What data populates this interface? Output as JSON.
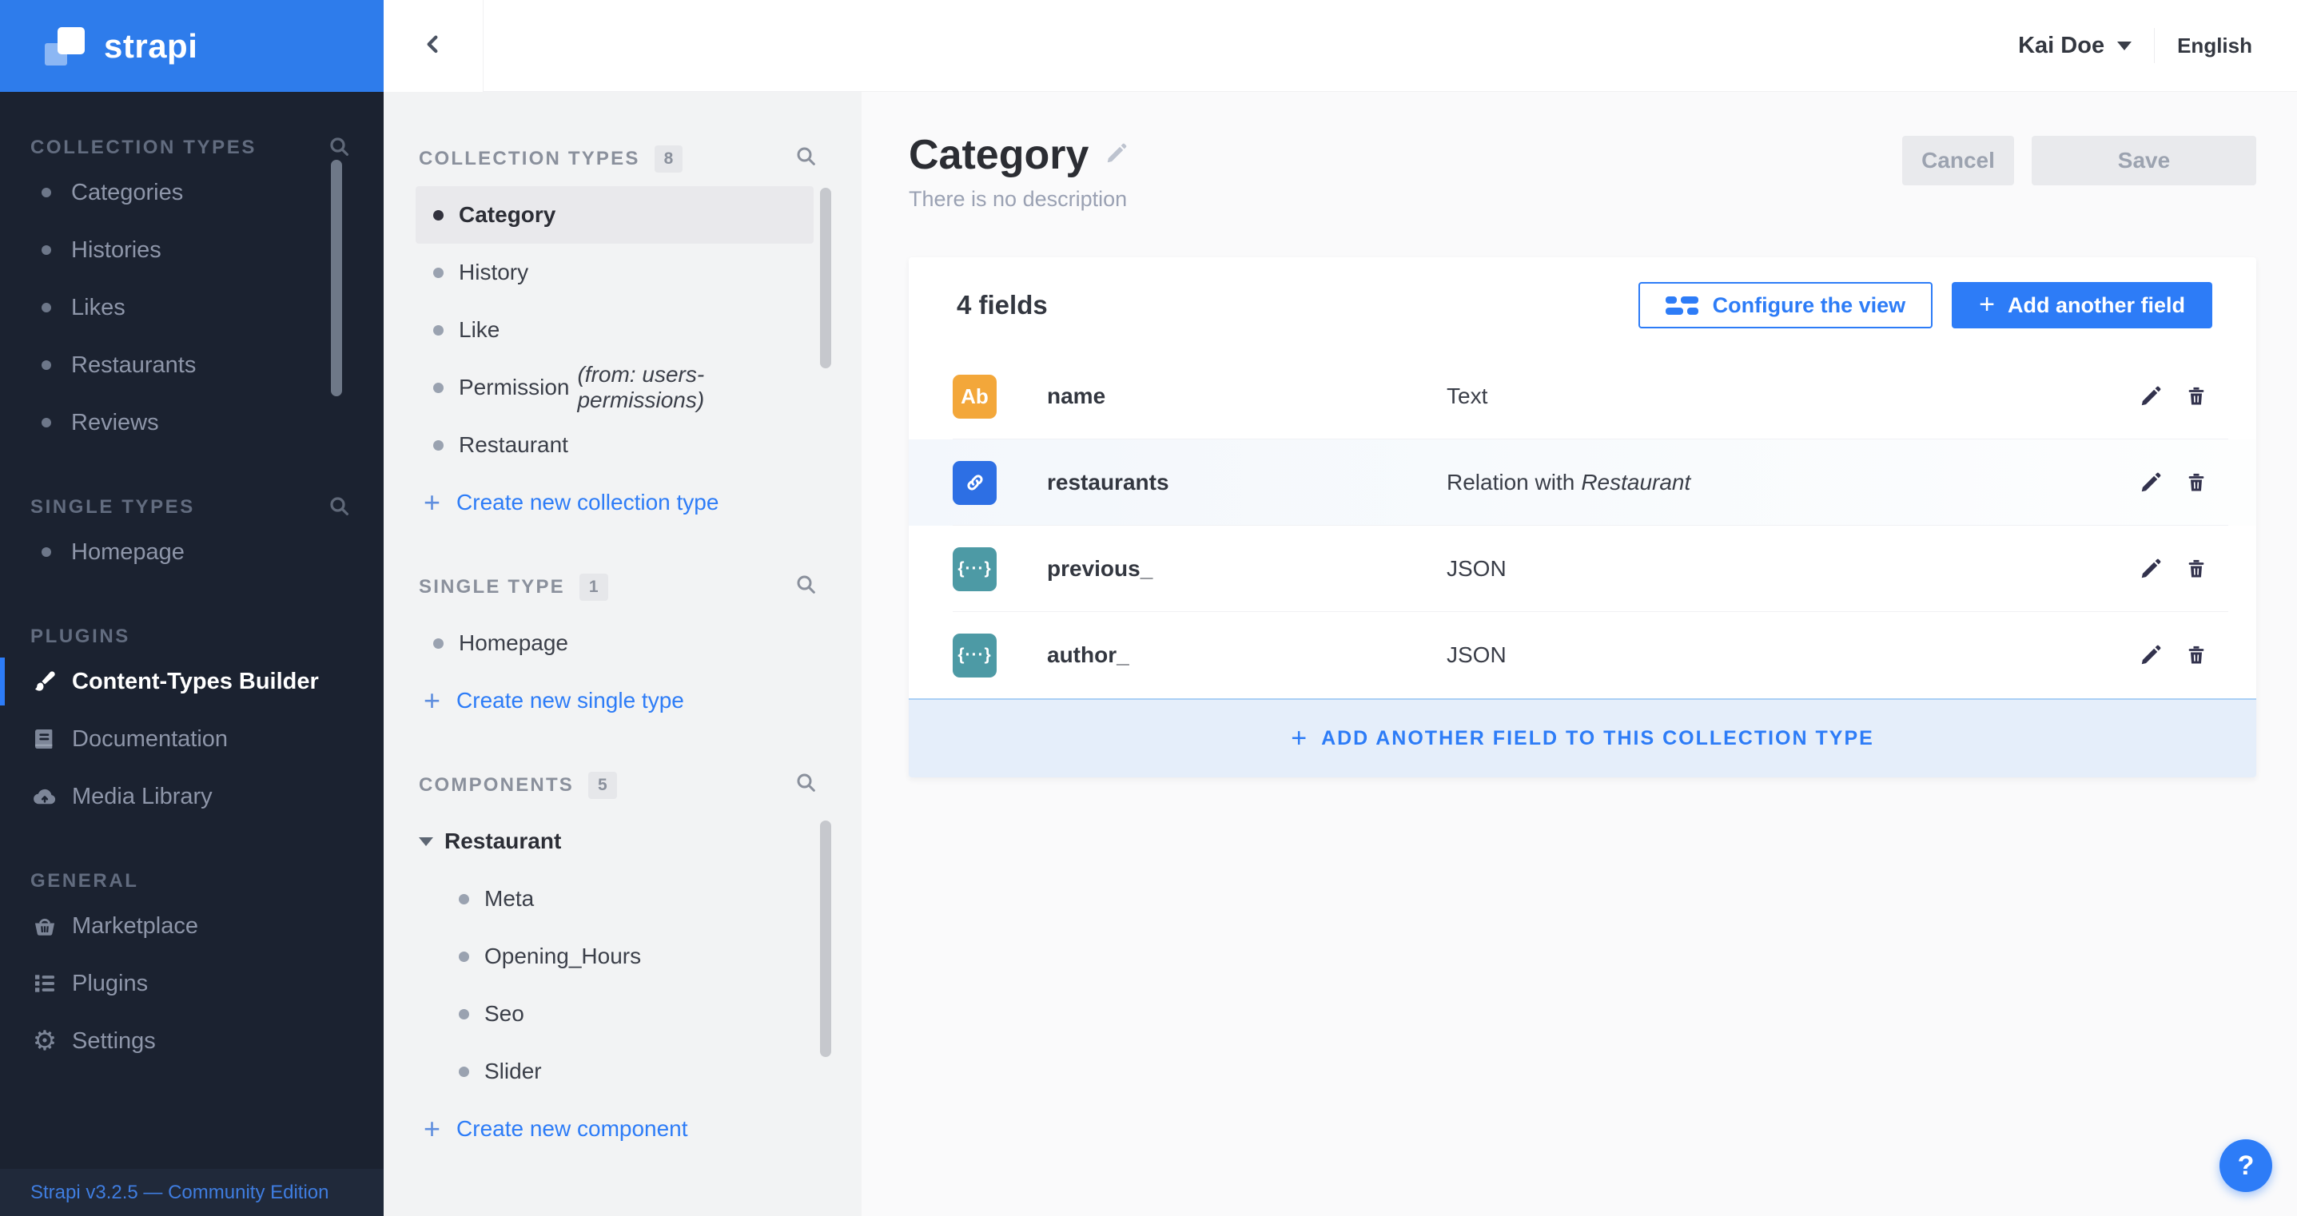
{
  "colors": {
    "accent": "#2d7cf7",
    "logo_bg": "#2e7ceb",
    "dark_sidebar_bg": "#1b2230",
    "subnav_bg": "#f2f3f4",
    "text_field_icon_bg": "#f3a73a",
    "relation_field_icon_bg": "#2d6fe4",
    "json_field_icon_bg": "#4d9aa5",
    "card_footer_bg": "#e5eefa"
  },
  "brand": {
    "logo_text": "strapi",
    "version_footer": "Strapi v3.2.5 — Community Edition"
  },
  "topbar": {
    "user": "Kai Doe",
    "language": "English"
  },
  "sidebar": {
    "collection_types": {
      "title": "COLLECTION TYPES",
      "items": [
        "Categories",
        "Histories",
        "Likes",
        "Restaurants",
        "Reviews"
      ]
    },
    "single_types": {
      "title": "SINGLE TYPES",
      "items": [
        "Homepage"
      ]
    },
    "plugins": {
      "title": "PLUGINS",
      "items": [
        "Content-Types Builder",
        "Documentation",
        "Media Library"
      ]
    },
    "general": {
      "title": "GENERAL",
      "items": [
        "Marketplace",
        "Plugins",
        "Settings"
      ]
    }
  },
  "subnav": {
    "collection_types": {
      "title": "COLLECTION TYPES",
      "count": "8",
      "items": [
        "Category",
        "History",
        "Like",
        "Permission",
        "Restaurant"
      ],
      "permission_note": "(from: users-permissions)",
      "create_label": "Create new collection type"
    },
    "single_type": {
      "title": "SINGLE TYPE",
      "count": "1",
      "items": [
        "Homepage"
      ],
      "create_label": "Create new single type"
    },
    "components": {
      "title": "COMPONENTS",
      "count": "5",
      "group_label": "Restaurant",
      "items": [
        "Meta",
        "Opening_Hours",
        "Seo",
        "Slider"
      ],
      "create_label": "Create new component"
    }
  },
  "page": {
    "title": "Category",
    "subtitle": "There is no description",
    "cancel_label": "Cancel",
    "save_label": "Save"
  },
  "fields": {
    "count_label": "4 fields",
    "configure_label": "Configure the view",
    "add_label": "Add another field",
    "rows": [
      {
        "glyph": "Ab",
        "name": "name",
        "type": "Text"
      },
      {
        "glyph": "",
        "name": "restaurants",
        "type": "Relation with",
        "type_italic": "Restaurant"
      },
      {
        "glyph": "{···}",
        "name": "previous_",
        "type": "JSON"
      },
      {
        "glyph": "{···}",
        "name": "author_",
        "type": "JSON"
      }
    ],
    "footer_label": "ADD ANOTHER FIELD TO THIS COLLECTION TYPE"
  },
  "help_label": "?"
}
